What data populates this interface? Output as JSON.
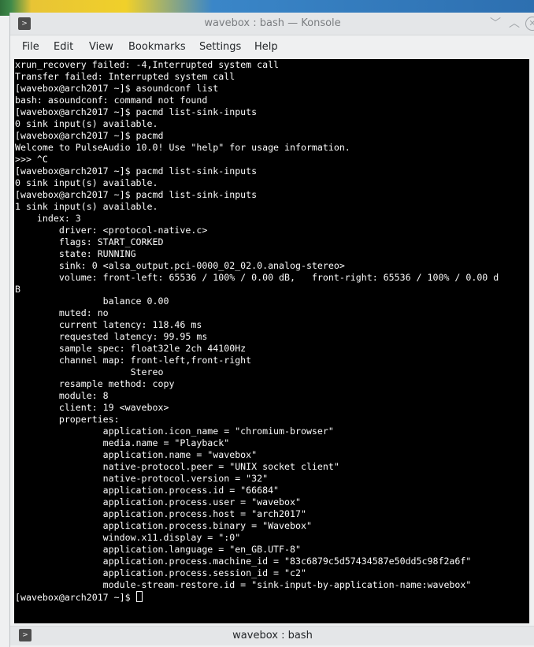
{
  "window": {
    "title": "wavebox : bash — Konsole",
    "icon": "terminal-icon",
    "buttons": {
      "minimize": "﹀",
      "maximize": "︿",
      "close": "✕"
    }
  },
  "menubar": {
    "items": [
      "File",
      "Edit",
      "View",
      "Bookmarks",
      "Settings",
      "Help"
    ]
  },
  "terminal": {
    "lines": [
      "xrun_recovery failed: -4,Interrupted system call",
      "Transfer failed: Interrupted system call",
      "[wavebox@arch2017 ~]$ asoundconf list",
      "bash: asoundconf: command not found",
      "[wavebox@arch2017 ~]$ pacmd list-sink-inputs",
      "0 sink input(s) available.",
      "[wavebox@arch2017 ~]$ pacmd",
      "Welcome to PulseAudio 10.0! Use \"help\" for usage information.",
      ">>> ^C",
      "[wavebox@arch2017 ~]$ pacmd list-sink-inputs",
      "0 sink input(s) available.",
      "[wavebox@arch2017 ~]$ pacmd list-sink-inputs",
      "1 sink input(s) available.",
      "    index: 3",
      "        driver: <protocol-native.c>",
      "        flags: START_CORKED",
      "        state: RUNNING",
      "        sink: 0 <alsa_output.pci-0000_02_02.0.analog-stereo>",
      "        volume: front-left: 65536 / 100% / 0.00 dB,   front-right: 65536 / 100% / 0.00 d",
      "B",
      "                balance 0.00",
      "        muted: no",
      "        current latency: 118.46 ms",
      "        requested latency: 99.95 ms",
      "        sample spec: float32le 2ch 44100Hz",
      "        channel map: front-left,front-right",
      "                     Stereo",
      "        resample method: copy",
      "        module: 8",
      "        client: 19 <wavebox>",
      "        properties:",
      "                application.icon_name = \"chromium-browser\"",
      "                media.name = \"Playback\"",
      "                application.name = \"wavebox\"",
      "                native-protocol.peer = \"UNIX socket client\"",
      "                native-protocol.version = \"32\"",
      "                application.process.id = \"66684\"",
      "                application.process.user = \"wavebox\"",
      "                application.process.host = \"arch2017\"",
      "                application.process.binary = \"Wavebox\"",
      "                window.x11.display = \":0\"",
      "                application.language = \"en_GB.UTF-8\"",
      "                application.process.machine_id = \"83c6879c5d57434587e50dd5c98f2a6f\"",
      "                application.process.session_id = \"c2\"",
      "                module-stream-restore.id = \"sink-input-by-application-name:wavebox\""
    ],
    "prompt": "[wavebox@arch2017 ~]$ "
  },
  "statusbar": {
    "title": "wavebox : bash",
    "icon": "terminal-icon"
  }
}
